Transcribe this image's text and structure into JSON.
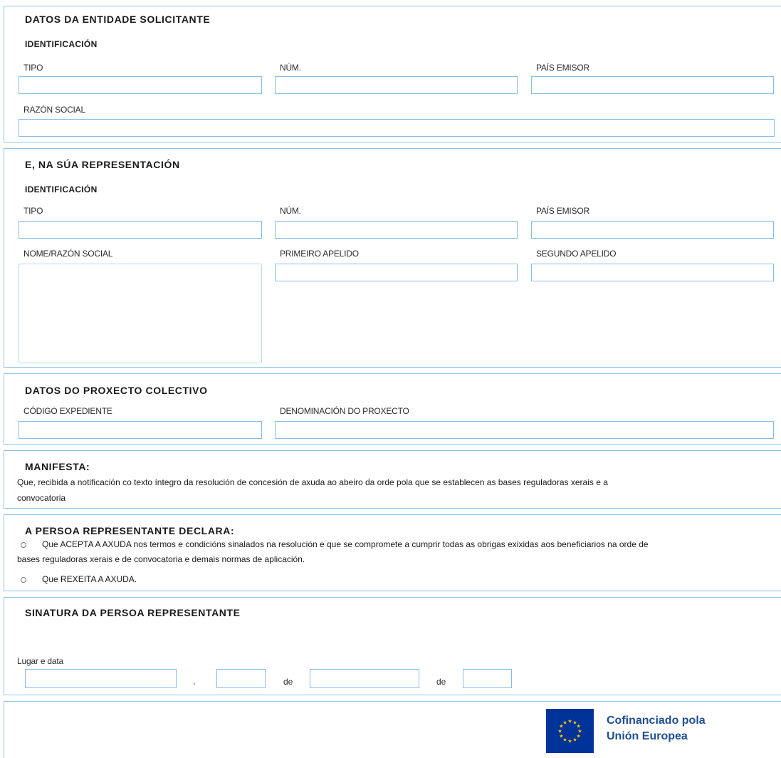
{
  "entidade": {
    "title": "DATOS DA ENTIDADE SOLICITANTE",
    "subtitle": "IDENTIFICACIÓN",
    "labels": {
      "tipo": "TIPO",
      "num": "NÚM.",
      "pais": "PAÍS EMISOR",
      "razon": "RAZÓN SOCIAL"
    }
  },
  "representacion": {
    "title": "E, NA SÚA REPRESENTACIÓN",
    "subtitle": "IDENTIFICACIÓN",
    "labels": {
      "tipo": "TIPO",
      "num": "NÚM.",
      "pais": "PAÍS EMISOR",
      "nome": "NOME/RAZÓN SOCIAL",
      "apelido1": "PRIMEIRO APELIDO",
      "apelido2": "SEGUNDO APELIDO"
    }
  },
  "proxecto": {
    "title": "DATOS DO PROXECTO COLECTIVO",
    "labels": {
      "codigo": "CÓDIGO EXPEDIENTE",
      "denominacion": "DENOMINACIÓN DO PROXECTO"
    }
  },
  "manifesta": {
    "title": "MANIFESTA:",
    "line1": "Que, recibida a notificación co texto íntegro da resolución de concesión de axuda ao abeiro da orde pola que se establecen as bases reguladoras xerais e a",
    "line2": "convocatoria"
  },
  "declara": {
    "title": "A PERSOA REPRESENTANTE DECLARA:",
    "option1_line1": "Que ACEPTA A AXUDA nos termos e condicións sinalados na resolución e que se compromete a cumprir todas as obrigas exixidas aos beneficiarios na orde de",
    "option1_line2": "bases reguladoras xerais e de convocatoria e demais normas de aplicación.",
    "option2": "Que REXEITA A AXUDA."
  },
  "sinatura": {
    "title": "SINATURA DA PERSOA REPRESENTANTE",
    "lugar_label": "Lugar e data",
    "comma": ",",
    "de1": "de",
    "de2": "de"
  },
  "footer": {
    "eu_line1": "Cofinanciado pola",
    "eu_line2": "Unión Europea",
    "colors": {
      "flag": "#003399",
      "stars": "#ffcc00",
      "text": "#1f4e94",
      "border": "#8fc2e8"
    }
  }
}
